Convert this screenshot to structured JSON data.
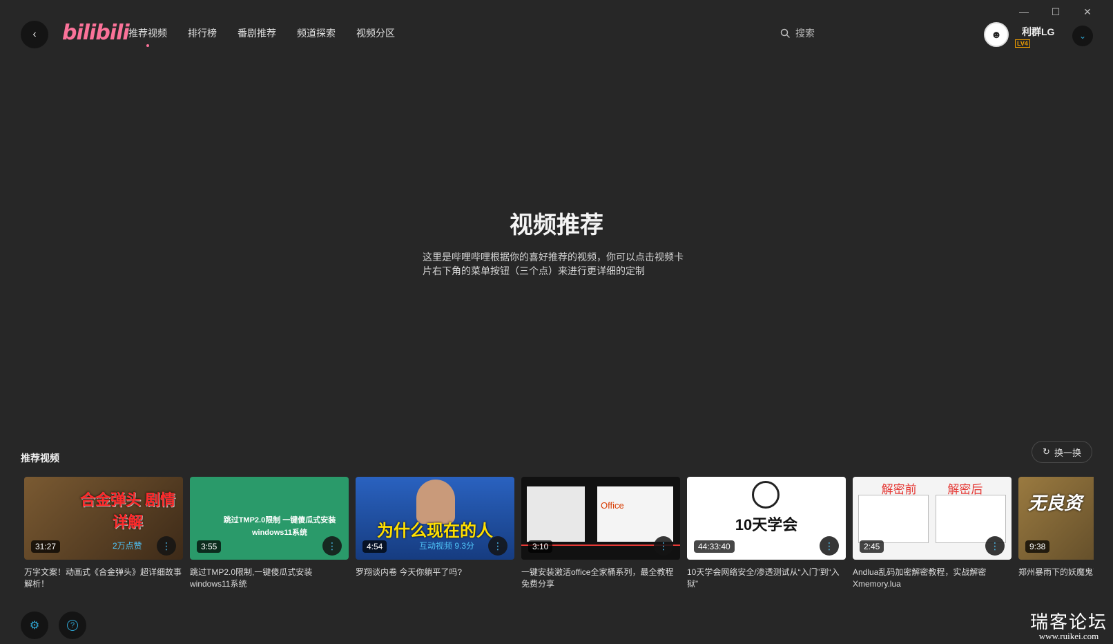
{
  "window": {
    "minimize": "—",
    "maximize": "☐",
    "close": "✕"
  },
  "header": {
    "back_icon": "‹",
    "logo": "bilibili",
    "nav": [
      {
        "label": "推荐视频",
        "active": true
      },
      {
        "label": "排行榜"
      },
      {
        "label": "番剧推荐"
      },
      {
        "label": "频道探索"
      },
      {
        "label": "视频分区"
      }
    ],
    "search_placeholder": "搜索",
    "user": {
      "name": "利群LG",
      "level": "LV4"
    }
  },
  "hero": {
    "title": "视频推荐",
    "desc": "这里是哔哩哔哩根据你的喜好推荐的视频，你可以点击视频卡片右下角的菜单按钮（三个点）来进行更详细的定制"
  },
  "section": {
    "title": "推荐视频",
    "refresh_label": "换一换"
  },
  "videos": [
    {
      "duration": "31:27",
      "badge": "2万点赞",
      "thumb_text": "合金弹头 剧情详解",
      "bg": "#6b4a2a",
      "title": "万字文案！动画式《合金弹头》超详细故事解析！"
    },
    {
      "duration": "3:55",
      "badge": "",
      "thumb_text": "跳过TMP2.0限制 一键傻瓜式安装windows11系统",
      "bg": "#2a9a6a",
      "title": "跳过TMP2.0限制,一键傻瓜式安装windows11系统"
    },
    {
      "duration": "4:54",
      "badge": "互动视频 9.3分",
      "thumb_text": "为什么现在的人",
      "bg": "#1f4fa0",
      "title": "罗翔谈内卷 今天你躺平了吗?"
    },
    {
      "duration": "3:10",
      "badge": "",
      "thumb_text": "Office",
      "bg": "#e8e8e8",
      "title": "一键安装激活office全家桶系列，最全教程免费分享"
    },
    {
      "duration": "44:33:40",
      "badge": "",
      "thumb_text": "10天学会",
      "bg": "#ffffff",
      "title": "10天学会网络安全/渗透测试从“入门”到“入狱”"
    },
    {
      "duration": "2:45",
      "badge": "",
      "thumb_text": "解密前 解密后",
      "bg": "#f4f4f4",
      "title": "Andlua乱码加密解密教程，实战解密Xmemory.lua"
    },
    {
      "duration": "9:38",
      "badge": "",
      "thumb_text": "无良资",
      "bg": "#8a6a30",
      "title": "郑州暴雨下的妖魔鬼营销！爽子姐卖惨求"
    }
  ],
  "footer": {
    "settings_icon": "⚙",
    "help_icon": "?",
    "watermark_cn": "瑞客论坛",
    "watermark_en": "www.ruikei.com"
  },
  "colors": {
    "background": "#272727",
    "accent_pink": "#fb7299",
    "accent_blue": "#2fa6d4"
  }
}
